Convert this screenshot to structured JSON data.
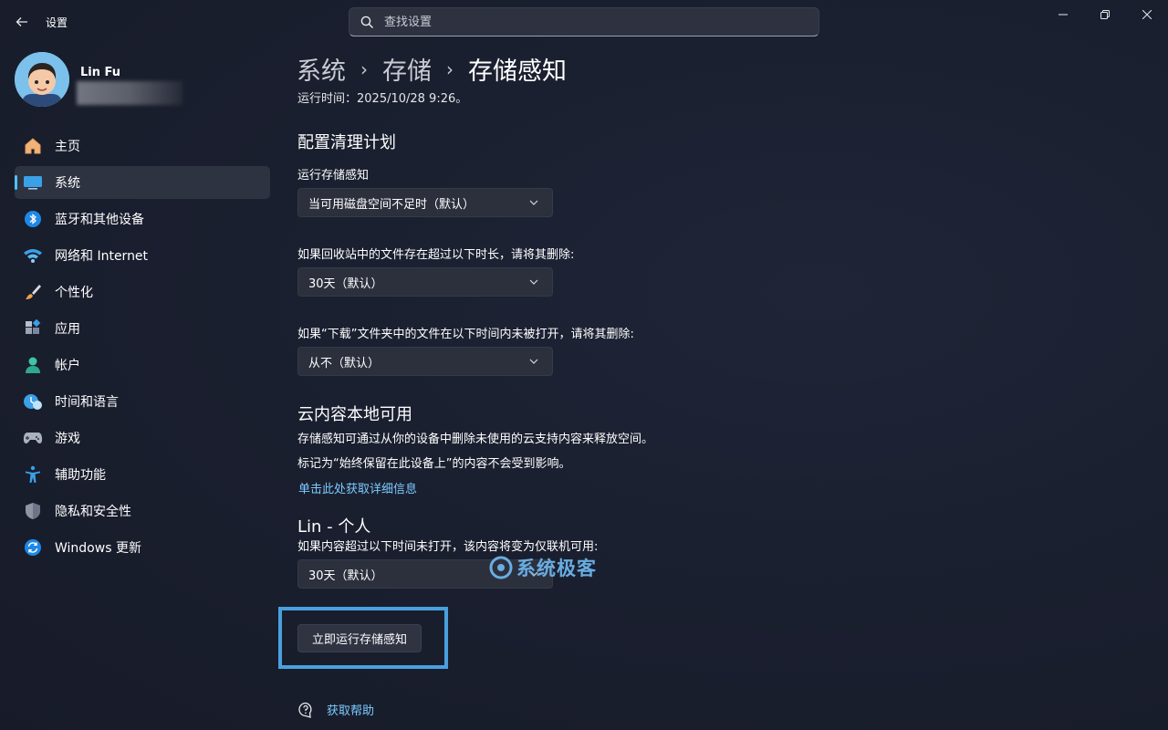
{
  "window": {
    "title": "设置",
    "search_placeholder": "查找设置"
  },
  "profile": {
    "name": "Lin Fu"
  },
  "sidebar": {
    "items": [
      {
        "label": "主页",
        "icon": "home-icon",
        "active": false
      },
      {
        "label": "系统",
        "icon": "system-icon",
        "active": true
      },
      {
        "label": "蓝牙和其他设备",
        "icon": "bluetooth-icon",
        "active": false
      },
      {
        "label": "网络和 Internet",
        "icon": "wifi-icon",
        "active": false
      },
      {
        "label": "个性化",
        "icon": "brush-icon",
        "active": false
      },
      {
        "label": "应用",
        "icon": "apps-icon",
        "active": false
      },
      {
        "label": "帐户",
        "icon": "account-icon",
        "active": false
      },
      {
        "label": "时间和语言",
        "icon": "time-language-icon",
        "active": false
      },
      {
        "label": "游戏",
        "icon": "gamepad-icon",
        "active": false
      },
      {
        "label": "辅助功能",
        "icon": "accessibility-icon",
        "active": false
      },
      {
        "label": "隐私和安全性",
        "icon": "shield-icon",
        "active": false
      },
      {
        "label": "Windows 更新",
        "icon": "update-icon",
        "active": false
      }
    ]
  },
  "breadcrumb": {
    "items": [
      "系统",
      "存储",
      "存储感知"
    ],
    "separator": "›"
  },
  "content": {
    "run_time_partial": "运行时间：2025/10/28 9:26。",
    "schedule_heading": "配置清理计划",
    "run_storage_sense_label": "运行存储感知",
    "run_storage_sense_value": "当可用磁盘空间不足时（默认）",
    "recycle_bin_label": "如果回收站中的文件存在超过以下时长，请将其删除:",
    "recycle_bin_value": "30天（默认）",
    "downloads_label": "如果“下载”文件夹中的文件在以下时间内未被打开，请将其删除:",
    "downloads_value": "从不（默认）",
    "cloud_heading": "云内容本地可用",
    "cloud_desc_1": "存储感知可通过从你的设备中删除未使用的云支持内容来释放空间。",
    "cloud_desc_2": "标记为“始终保留在此设备上”的内容不会受到影响。",
    "cloud_link": "单击此处获取详细信息",
    "onedrive_heading": "Lin - 个人",
    "onedrive_label": "如果内容超过以下时间未打开，该内容将变为仅联机可用:",
    "onedrive_value": "30天（默认）",
    "run_now_button": "立即运行存储感知",
    "help_link": "获取帮助"
  },
  "watermark": {
    "text": "系统极客"
  },
  "colors": {
    "accent": "#4cc2ff",
    "link": "#7ccbff",
    "highlight_border": "#4aa0de"
  }
}
